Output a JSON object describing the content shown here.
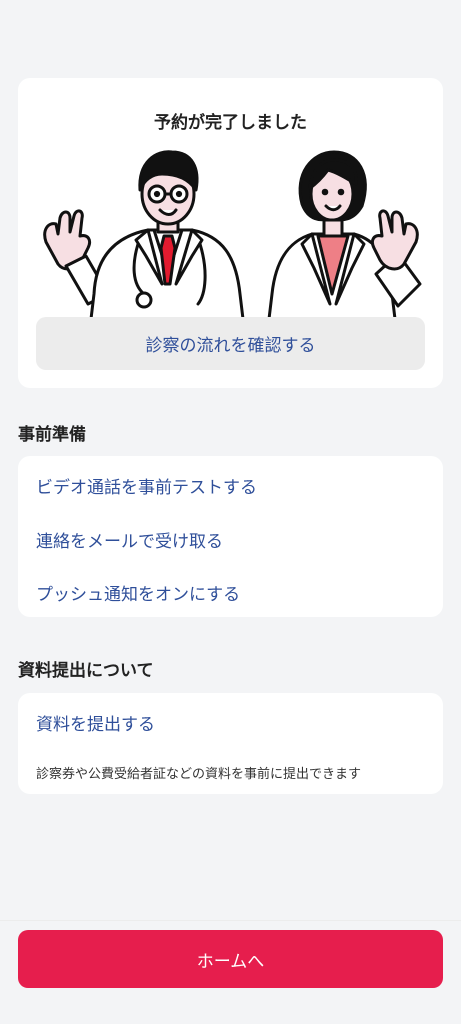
{
  "hero": {
    "title": "予約が完了しました",
    "flow_button_label": "診察の流れを確認する"
  },
  "preparation": {
    "heading": "事前準備",
    "items": [
      {
        "label": "ビデオ通話を事前テストする"
      },
      {
        "label": "連絡をメールで受け取る"
      },
      {
        "label": "プッシュ通知をオンにする"
      }
    ]
  },
  "documents": {
    "heading": "資料提出について",
    "submit_label": "資料を提出する",
    "description": "診察券や公費受給者証などの資料を事前に提出できます"
  },
  "footer": {
    "home_button_label": "ホームへ"
  },
  "colors": {
    "accent": "#e61e4d",
    "link": "#2f4f9a",
    "background": "#f3f4f6"
  }
}
